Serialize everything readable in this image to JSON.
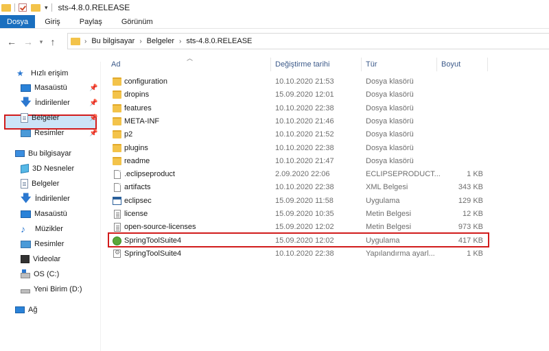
{
  "window": {
    "title": "sts-4.8.0.RELEASE"
  },
  "ribbon": {
    "tabs": [
      "Dosya",
      "Giriş",
      "Paylaş",
      "Görünüm"
    ]
  },
  "address": {
    "crumbs": [
      "Bu bilgisayar",
      "Belgeler",
      "sts-4.8.0.RELEASE"
    ]
  },
  "sidebar": {
    "quick_access": "Hızlı erişim",
    "quick_items": [
      "Masaüstü",
      "İndirilenler",
      "Belgeler",
      "Resimler"
    ],
    "this_pc": "Bu bilgisayar",
    "pc_items": [
      "3D Nesneler",
      "Belgeler",
      "İndirilenler",
      "Masaüstü",
      "Müzikler",
      "Resimler",
      "Videolar",
      "OS (C:)",
      "Yeni Birim (D:)"
    ],
    "network": "Ağ",
    "selected": "Belgeler"
  },
  "columns": {
    "name": "Ad",
    "date": "Değiştirme tarihi",
    "type": "Tür",
    "size": "Boyut"
  },
  "files": [
    {
      "name": "configuration",
      "date": "10.10.2020 21:53",
      "type": "Dosya klasörü",
      "size": "",
      "icon": "folder-icon"
    },
    {
      "name": "dropins",
      "date": "15.09.2020 12:01",
      "type": "Dosya klasörü",
      "size": "",
      "icon": "folder-icon"
    },
    {
      "name": "features",
      "date": "10.10.2020 22:38",
      "type": "Dosya klasörü",
      "size": "",
      "icon": "folder-icon"
    },
    {
      "name": "META-INF",
      "date": "10.10.2020 21:46",
      "type": "Dosya klasörü",
      "size": "",
      "icon": "folder-icon"
    },
    {
      "name": "p2",
      "date": "10.10.2020 21:52",
      "type": "Dosya klasörü",
      "size": "",
      "icon": "folder-icon"
    },
    {
      "name": "plugins",
      "date": "10.10.2020 22:38",
      "type": "Dosya klasörü",
      "size": "",
      "icon": "folder-icon"
    },
    {
      "name": "readme",
      "date": "10.10.2020 21:47",
      "type": "Dosya klasörü",
      "size": "",
      "icon": "folder-icon"
    },
    {
      "name": ".eclipseproduct",
      "date": "2.09.2020 22:06",
      "type": "ECLIPSEPRODUCT...",
      "size": "1 KB",
      "icon": "file-icon"
    },
    {
      "name": "artifacts",
      "date": "10.10.2020 22:38",
      "type": "XML Belgesi",
      "size": "343 KB",
      "icon": "file-icon"
    },
    {
      "name": "eclipsec",
      "date": "15.09.2020 11:58",
      "type": "Uygulama",
      "size": "129 KB",
      "icon": "exe-icon"
    },
    {
      "name": "license",
      "date": "15.09.2020 10:35",
      "type": "Metin Belgesi",
      "size": "12 KB",
      "icon": "text-file-icon"
    },
    {
      "name": "open-source-licenses",
      "date": "15.09.2020 12:02",
      "type": "Metin Belgesi",
      "size": "973 KB",
      "icon": "text-file-icon"
    },
    {
      "name": "SpringToolSuite4",
      "date": "15.09.2020 12:02",
      "type": "Uygulama",
      "size": "417 KB",
      "icon": "spring-icon"
    },
    {
      "name": "SpringToolSuite4",
      "date": "10.10.2020 22:38",
      "type": "Yapılandırma ayarl...",
      "size": "1 KB",
      "icon": "config-file-icon"
    }
  ],
  "highlighted_file_index": 12
}
